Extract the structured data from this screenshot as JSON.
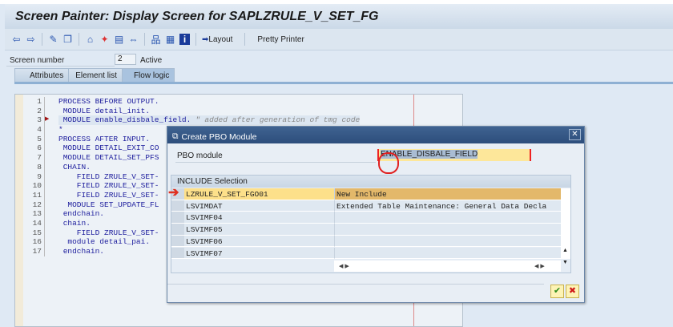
{
  "window": {
    "title": "Screen Painter: Display Screen for SAPLZRULE_V_SET_FG"
  },
  "toolbar": {
    "layout_label": "Layout",
    "pretty_printer_label": "Pretty Printer"
  },
  "screen": {
    "number_label": "Screen number",
    "number": "2",
    "status": "Active"
  },
  "tabs": [
    {
      "label": "Attributes"
    },
    {
      "label": "Element list"
    },
    {
      "label": "Flow logic"
    }
  ],
  "code": {
    "lines": [
      {
        "n": "1",
        "code": "PROCESS BEFORE OUTPUT.",
        "comment": ""
      },
      {
        "n": "2",
        "code": " MODULE detail_init.",
        "comment": ""
      },
      {
        "n": "3",
        "code": " MODULE enable_disbale_field.",
        "comment": " \" added after generation of tmg code"
      },
      {
        "n": "4",
        "code": "*",
        "comment": ""
      },
      {
        "n": "5",
        "code": "PROCESS AFTER INPUT.",
        "comment": ""
      },
      {
        "n": "6",
        "code": " MODULE DETAIL_EXIT_CO",
        "comment": ""
      },
      {
        "n": "7",
        "code": " MODULE DETAIL_SET_PFS",
        "comment": ""
      },
      {
        "n": "8",
        "code": " CHAIN.",
        "comment": ""
      },
      {
        "n": "9",
        "code": "    FIELD ZRULE_V_SET-",
        "comment": ""
      },
      {
        "n": "10",
        "code": "    FIELD ZRULE_V_SET-",
        "comment": ""
      },
      {
        "n": "11",
        "code": "    FIELD ZRULE_V_SET-",
        "comment": ""
      },
      {
        "n": "12",
        "code": "  MODULE SET_UPDATE_FL",
        "comment": ""
      },
      {
        "n": "13",
        "code": " endchain.",
        "comment": ""
      },
      {
        "n": "14",
        "code": " chain.",
        "comment": ""
      },
      {
        "n": "15",
        "code": "    FIELD ZRULE_V_SET-",
        "comment": ""
      },
      {
        "n": "16",
        "code": "  module detail_pai.",
        "comment": ""
      },
      {
        "n": "17",
        "code": " endchain.",
        "comment": ""
      }
    ]
  },
  "dialog": {
    "title": "Create PBO Module",
    "pbo_label": "PBO module",
    "pbo_value": "ENABLE_DISBALE_FIELD",
    "group_title": "INCLUDE Selection",
    "rows": [
      {
        "include": "LZRULE_V_SET_FGO01",
        "desc": "New Include"
      },
      {
        "include": "LSVIMDAT",
        "desc": "Extended Table Maintenance: General Data Decla"
      },
      {
        "include": "LSVIMF04",
        "desc": ""
      },
      {
        "include": "LSVIMF05",
        "desc": ""
      },
      {
        "include": "LSVIMF06",
        "desc": ""
      },
      {
        "include": "LSVIMF07",
        "desc": ""
      }
    ]
  }
}
